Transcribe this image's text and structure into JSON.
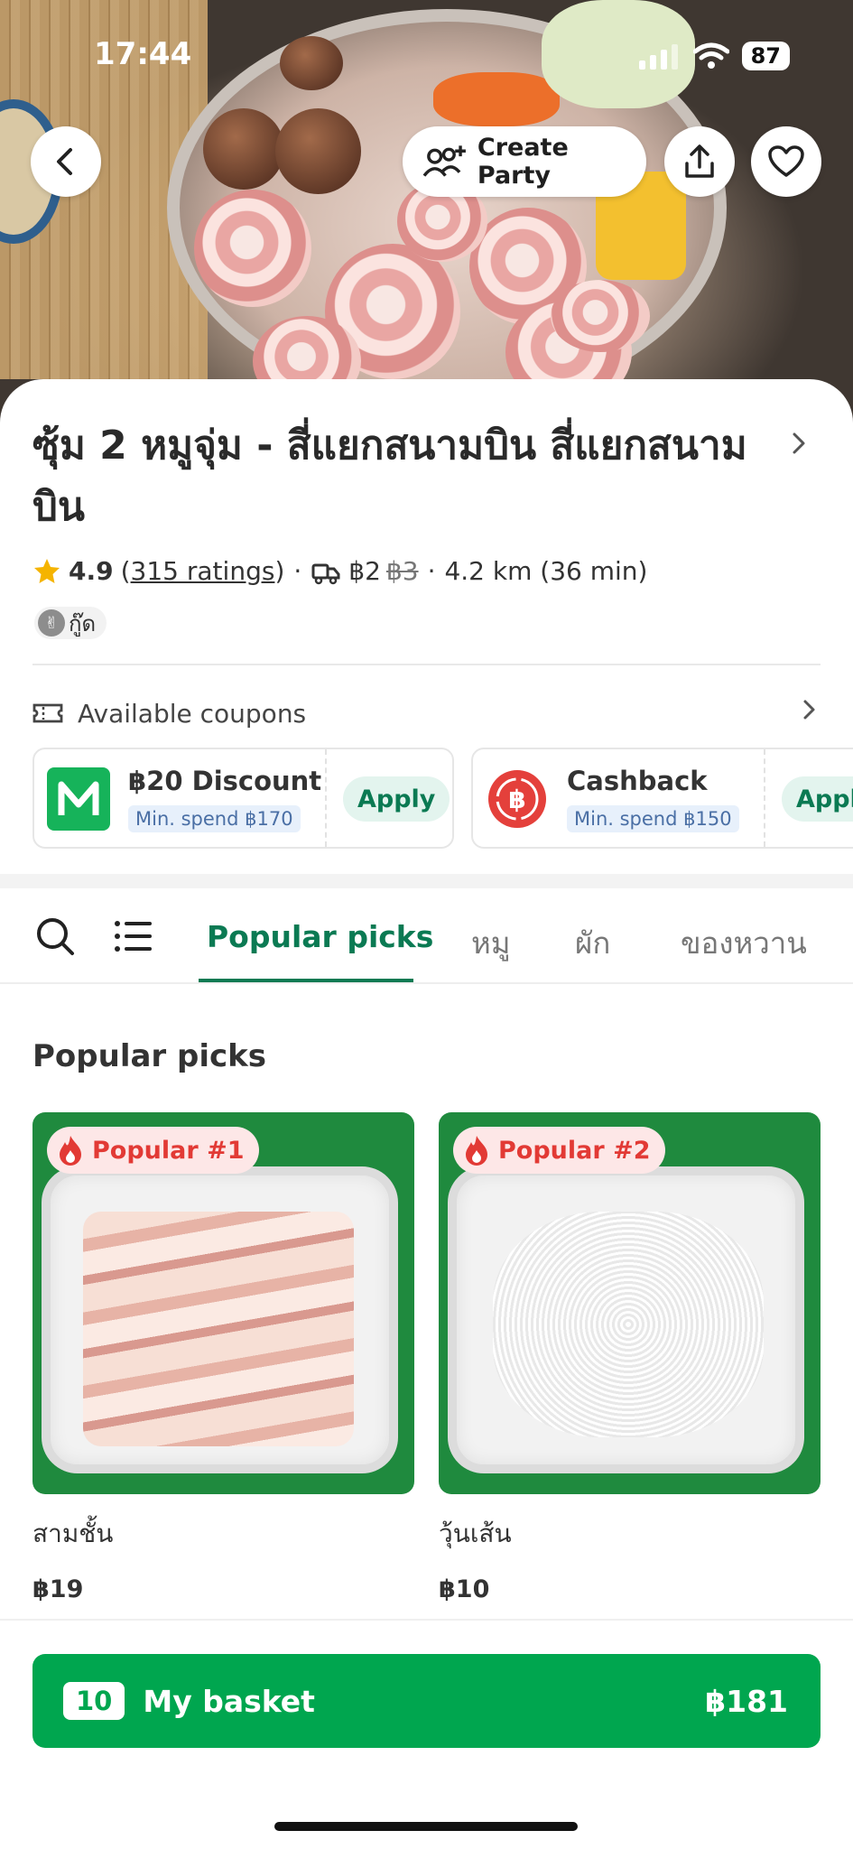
{
  "status_bar": {
    "time": "17:44",
    "battery": "87"
  },
  "header": {
    "create_party_label": "Create Party"
  },
  "restaurant": {
    "name": "ซุ้ม 2 หมูจุ่ม - สี่แยกสนามบิน สี่แยกสนามบิน",
    "rating": "4.9",
    "ratings_count": "315 ratings",
    "delivery_fee": "฿2",
    "original_fee": "฿3",
    "distance_time": "4.2 km (36 min)",
    "badge": "กู๊ด"
  },
  "coupons": {
    "title": "Available coupons",
    "items": [
      {
        "title": "฿20 Discount",
        "min_spend": "Min. spend ฿170",
        "action": "Apply"
      },
      {
        "title": "Cashback",
        "min_spend": "Min. spend ฿150",
        "action": "Apply"
      }
    ]
  },
  "tabs": [
    "Popular picks",
    "หมู",
    "ผัก",
    "ของหวาน"
  ],
  "popular": {
    "section_title": "Popular picks",
    "items": [
      {
        "badge": "Popular #1",
        "name": "สามชั้น",
        "price": "฿19"
      },
      {
        "badge": "Popular #2",
        "name": "วุ้นเส้น",
        "price": "฿10"
      }
    ]
  },
  "basket": {
    "count": "10",
    "label": "My basket",
    "total": "฿181"
  },
  "colors": {
    "brand_green": "#00a64f",
    "tab_active": "#0b7a53",
    "popular_red": "#e23a35",
    "apply_text": "#0b7a53"
  },
  "icons": [
    "back-arrow-icon",
    "add-person-icon",
    "share-icon",
    "heart-icon",
    "chevron-right-icon",
    "star-icon",
    "delivery-icon",
    "coupon-icon",
    "search-icon",
    "menu-list-icon",
    "fire-icon"
  ]
}
